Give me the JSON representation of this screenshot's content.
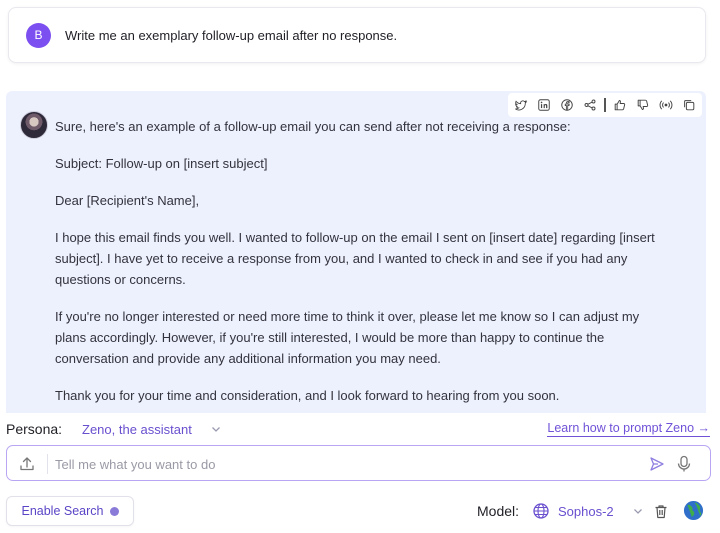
{
  "user_message": {
    "avatar_initial": "B",
    "text": "Write me an exemplary follow-up email after no response."
  },
  "response": {
    "toolbar_icons": [
      "twitter-icon",
      "linkedin-icon",
      "facebook-icon",
      "share-icon",
      "thumbs-up-icon",
      "thumbs-down-icon",
      "speaker-icon",
      "copy-icon"
    ],
    "paragraphs": [
      "Sure, here's an example of a follow-up email you can send after not receiving a response:",
      "Subject: Follow-up on [insert subject]",
      "Dear [Recipient's Name],",
      "I hope this email finds you well. I wanted to follow-up on the email I sent on [insert date] regarding [insert subject]. I have yet to receive a response from you, and I wanted to check in and see if you had any questions or concerns.",
      "If you're no longer interested or need more time to think it over, please let me know so I can adjust my plans accordingly. However, if you're still interested, I would be more than happy to continue the conversation and provide any additional information you may need.",
      "Thank you for your time and consideration, and I look forward to hearing from you soon."
    ]
  },
  "persona": {
    "label": "Persona:",
    "value": "Zeno, the assistant",
    "learn_link": "Learn how to prompt Zeno →"
  },
  "input": {
    "placeholder": "Tell me what you want to do",
    "value": ""
  },
  "bottom": {
    "enable_search_label": "Enable Search",
    "model_label": "Model:",
    "model_value": "Sophos-2"
  },
  "colors": {
    "accent": "#6a4fcf",
    "response_bg": "#edf1fd",
    "input_border": "#b9a6f3"
  }
}
